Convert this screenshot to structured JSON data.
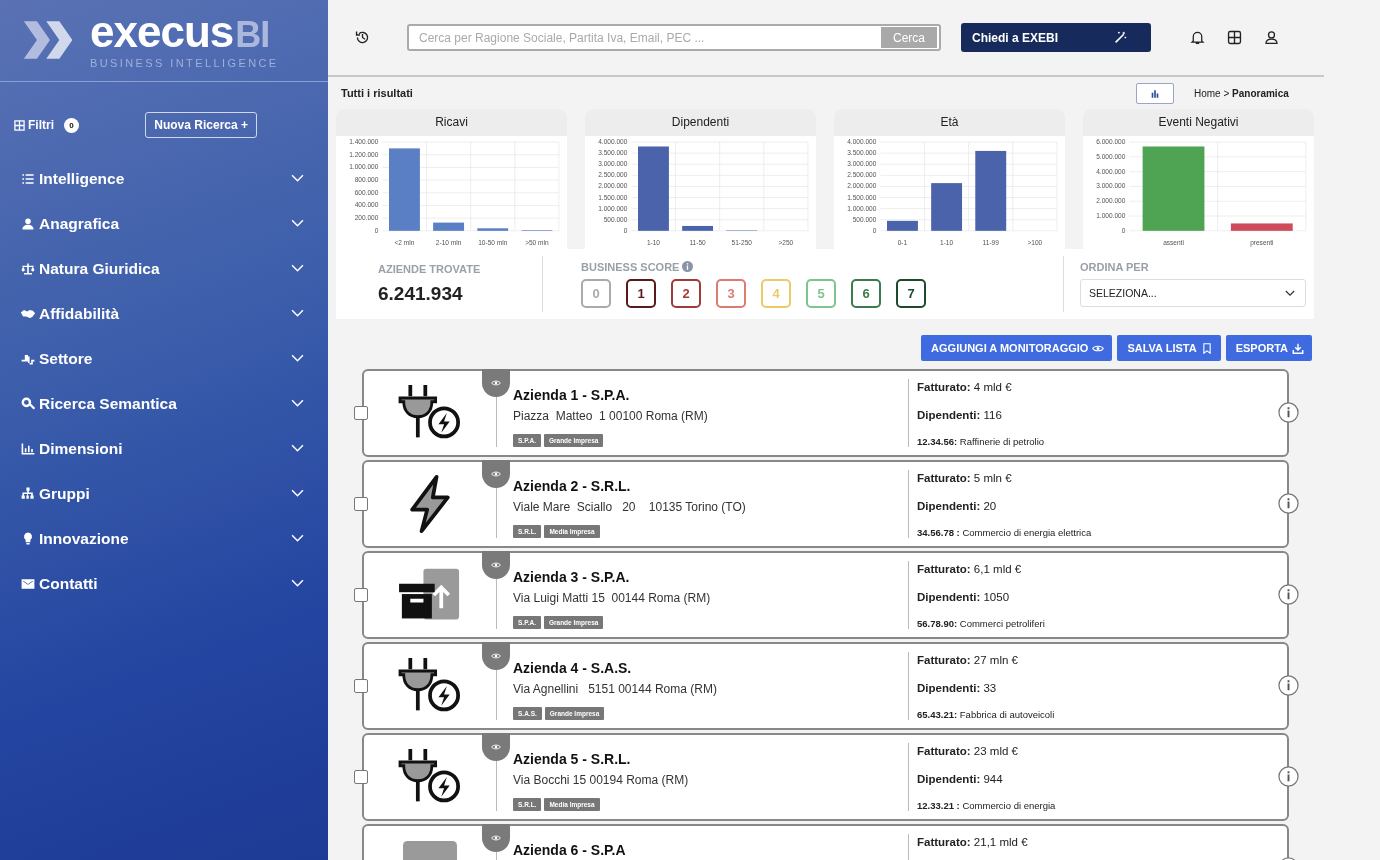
{
  "brand": {
    "name": "execus",
    "suffix": "BI",
    "tagline": "BUSINESS INTELLIGENCE"
  },
  "filters": {
    "label": "Filtri",
    "count": "0",
    "new_search": "Nuova Ricerca +"
  },
  "sidebar": {
    "items": [
      {
        "label": "Intelligence",
        "expanded": false
      },
      {
        "label": "Anagrafica",
        "expanded": false
      },
      {
        "label": "Natura Giuridica",
        "expanded": false
      },
      {
        "label": "Affidabilità",
        "expanded": false
      },
      {
        "label": "Settore",
        "expanded": false
      },
      {
        "label": "Ricerca Semantica",
        "expanded": false
      },
      {
        "label": "Dimensioni",
        "expanded": false
      },
      {
        "label": "Gruppi",
        "expanded": false
      },
      {
        "label": "Innovazione",
        "expanded": false
      },
      {
        "label": "Contatti",
        "expanded": false
      }
    ]
  },
  "search": {
    "placeholder": "Cerca per Ragione Sociale, Partita Iva, Email, PEC ...",
    "button": "Cerca"
  },
  "ask_button": "Chiedi a EXEBI",
  "results_title": "Tutti i risultati",
  "breadcrumb": {
    "home": "Home >",
    "current": "Panoramica"
  },
  "charts": [
    {
      "chart_data": {
        "type": "bar",
        "title": "Ricavi",
        "categories": [
          "<2 mln",
          "2-10 mln",
          "10-50 mln",
          ">50 mln"
        ],
        "grid": true,
        "series": [
          {
            "color": "#5b7fc4",
            "values": [
              1300000,
              130000,
              40000,
              10000
            ]
          }
        ],
        "ylim": [
          0,
          1400000
        ],
        "yticks": [
          {
            "value": 0,
            "label": "0"
          },
          {
            "value": 200000,
            "label": "200.000"
          },
          {
            "value": 400000,
            "label": "400.000"
          },
          {
            "value": 600000,
            "label": "600.000"
          },
          {
            "value": 800000,
            "label": "800.000"
          },
          {
            "value": 1000000,
            "label": "1.000.000"
          },
          {
            "value": 1200000,
            "label": "1.200.000"
          },
          {
            "value": 1400000,
            "label": "1.400.000"
          }
        ]
      }
    },
    {
      "chart_data": {
        "type": "bar",
        "title": "Dipendenti",
        "categories": [
          "1-10",
          "11-50",
          "51-250",
          ">250"
        ],
        "grid": true,
        "series": [
          {
            "color": "#4a63aa",
            "values": [
              3800000,
              220000,
              20000,
              null
            ]
          }
        ],
        "ylim": [
          0,
          4000000
        ],
        "yticks": [
          {
            "value": 0,
            "label": "0"
          },
          {
            "value": 500000,
            "label": "500.000"
          },
          {
            "value": 1000000,
            "label": "1.000.000"
          },
          {
            "value": 1500000,
            "label": "1.500.000"
          },
          {
            "value": 2000000,
            "label": "2.000.000"
          },
          {
            "value": 2500000,
            "label": "2.500.000"
          },
          {
            "value": 3000000,
            "label": "3.000.000"
          },
          {
            "value": 3500000,
            "label": "3.500.000"
          },
          {
            "value": 4000000,
            "label": "4.000.000"
          }
        ]
      }
    },
    {
      "chart_data": {
        "type": "bar",
        "title": "Età",
        "categories": [
          "0-1",
          "1-10",
          "11-99",
          ">100"
        ],
        "grid": true,
        "series": [
          {
            "color": "#4a63aa",
            "values": [
              450000,
              2150000,
              3600000,
              null
            ]
          }
        ],
        "ylim": [
          0,
          4000000
        ],
        "yticks": [
          {
            "value": 0,
            "label": "0"
          },
          {
            "value": 500000,
            "label": "500.000"
          },
          {
            "value": 1000000,
            "label": "1.000.000"
          },
          {
            "value": 1500000,
            "label": "1.500.000"
          },
          {
            "value": 2000000,
            "label": "2.000.000"
          },
          {
            "value": 2500000,
            "label": "2.500.000"
          },
          {
            "value": 3000000,
            "label": "3.000.000"
          },
          {
            "value": 3500000,
            "label": "3.500.000"
          },
          {
            "value": 4000000,
            "label": "4.000.000"
          }
        ]
      }
    },
    {
      "chart_data": {
        "type": "bar",
        "title": "Eventi Negativi",
        "categories": [
          "assenti",
          "presenti"
        ],
        "grid": true,
        "series": [
          {
            "color": "#4ea453",
            "values": [
              5700000,
              null
            ]
          },
          {
            "color": "#cf4a5a",
            "values": [
              null,
              500000
            ]
          }
        ],
        "ylim": [
          0,
          6000000
        ],
        "yticks": [
          {
            "value": 0,
            "label": "0"
          },
          {
            "value": 1000000,
            "label": "1.000.000"
          },
          {
            "value": 2000000,
            "label": "2.000.000"
          },
          {
            "value": 3000000,
            "label": "3.000.000"
          },
          {
            "value": 4000000,
            "label": "4.000.000"
          },
          {
            "value": 5000000,
            "label": "5.000.000"
          },
          {
            "value": 6000000,
            "label": "6.000.000"
          }
        ]
      }
    }
  ],
  "summary": {
    "found_label": "AZIENDE TROVATE",
    "found_value": "6.241.934",
    "score_label": "BUSINESS SCORE",
    "scores": [
      {
        "label": "0",
        "color": "#aaaaaa",
        "selected": false
      },
      {
        "label": "1",
        "color": "#5a1a1a",
        "selected": false
      },
      {
        "label": "2",
        "color": "#a33a3a",
        "selected": false
      },
      {
        "label": "3",
        "color": "#dc7b72",
        "selected": false
      },
      {
        "label": "4",
        "color": "#ecc96a",
        "selected": false
      },
      {
        "label": "5",
        "color": "#7fc48f",
        "selected": false
      },
      {
        "label": "6",
        "color": "#3b7b4d",
        "selected": false
      },
      {
        "label": "7",
        "color": "#1e4a2c",
        "selected": false
      }
    ],
    "sort_label": "ORDINA PER",
    "sort_value": "SELEZIONA..."
  },
  "actions": [
    "AGGIUNGI A MONITORAGGIO",
    "SALVA LISTA",
    "ESPORTA"
  ],
  "companies": [
    {
      "name": "Azienda 1 - S.P.A.",
      "address": "Piazza  Matteo  1 00100 Roma (RM)",
      "tags": [
        "S.P.A.",
        "Grande Impresa"
      ],
      "revenue_label": "Fatturato:",
      "revenue": "4 mld €",
      "employees_label": "Dipendenti:",
      "employees": "116",
      "ateco_code": "12.34.56:",
      "ateco_desc": "Raffinerie di petrolio",
      "checked": false
    },
    {
      "name": "Azienda 2 - S.R.L.",
      "address": "Viale Mare  Sciallo   20    10135 Torino (TO)",
      "tags": [
        "S.R.L.",
        "Media Impresa"
      ],
      "revenue_label": "Fatturato:",
      "revenue": "5 mln €",
      "employees_label": "Dipendenti:",
      "employees": "20",
      "ateco_code": "34.56.78 :",
      "ateco_desc": "Commercio di energia elettrica",
      "checked": false
    },
    {
      "name": "Azienda 3 - S.P.A.",
      "address": "Via Luigi Matti 15  00144 Roma (RM)",
      "tags": [
        "S.P.A.",
        "Grande Impresa"
      ],
      "revenue_label": "Fatturato:",
      "revenue": "6,1 mld €",
      "employees_label": "Dipendenti:",
      "employees": "1050",
      "ateco_code": "56.78.90:",
      "ateco_desc": "Commerci petroliferi",
      "checked": false
    },
    {
      "name": "Azienda 4 - S.A.S.",
      "address": "Via Agnellini   5151 00144 Roma (RM)",
      "tags": [
        "S.A.S.",
        "Grande Impresa"
      ],
      "revenue_label": "Fatturato:",
      "revenue": "27 mln €",
      "employees_label": "Dipendenti:",
      "employees": "33",
      "ateco_code": "65.43.21:",
      "ateco_desc": "Fabbrica di autoveicoli",
      "checked": false
    },
    {
      "name": "Azienda 5 - S.R.L.",
      "address": "Via Bocchi 15 00194 Roma (RM)",
      "tags": [
        "S.R.L.",
        "Media Impresa"
      ],
      "revenue_label": "Fatturato:",
      "revenue": "23 mld €",
      "employees_label": "Dipendenti:",
      "employees": "944",
      "ateco_code": "12.33.21 :",
      "ateco_desc": "Commercio di energia",
      "checked": false
    },
    {
      "name": "Azienda 6 - S.P.A",
      "revenue_label": "Fatturato:",
      "revenue": "21,1 mld €"
    }
  ]
}
